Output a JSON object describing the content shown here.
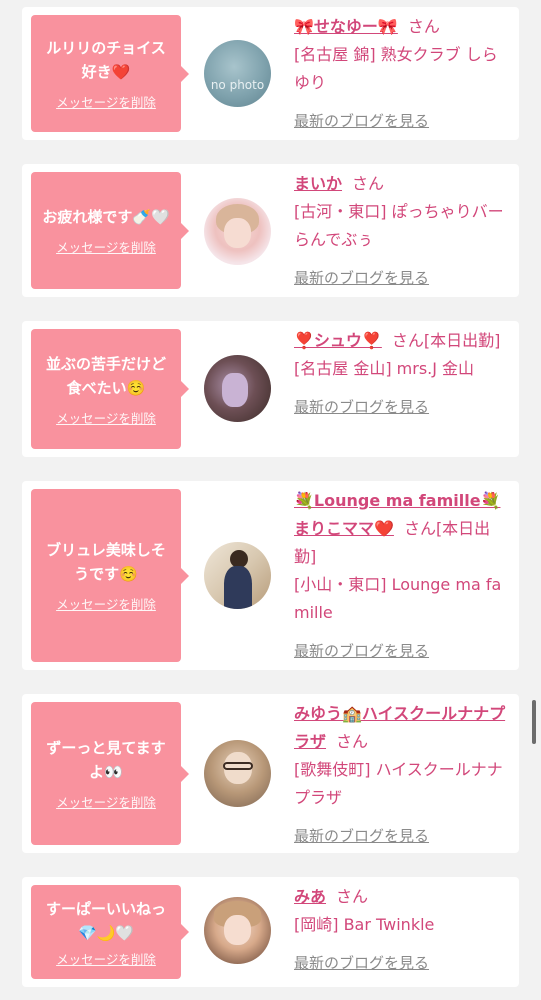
{
  "cards": [
    {
      "message": "ルリリのチョイス好き❤️",
      "delete_label": "メッセージを削除",
      "name": "🎀せなゆー🎀",
      "san": "さん",
      "shop": "[名古屋 錦] 熟女クラブ しらゆり",
      "blog_link": "最新のブログを見る",
      "avatar_text": "no photo"
    },
    {
      "message": "お疲れ様です🍼🤍",
      "delete_label": "メッセージを削除",
      "name": "まいか",
      "san": "さん",
      "shop": "[古河・東口] ぽっちゃりバー らんでぶぅ",
      "blog_link": "最新のブログを見る"
    },
    {
      "message": "並ぶの苦手だけど食べたい☺️",
      "delete_label": "メッセージを削除",
      "name": "❣️シュウ❣️",
      "san": "さん[本日出勤]",
      "shop": "[名古屋 金山] mrs.J 金山",
      "blog_link": "最新のブログを見る"
    },
    {
      "message": "ブリュレ美味しそうです☺️",
      "delete_label": "メッセージを削除",
      "name": "💐Lounge ma famille💐まりこママ❤️",
      "san": "さん[本日出勤]",
      "shop": "[小山・東口] Lounge ma famille",
      "blog_link": "最新のブログを見る"
    },
    {
      "message": "ずーっと見てますよ👀",
      "delete_label": "メッセージを削除",
      "name": "みゆう🏫ハイスクールナナプラザ",
      "san": "さん",
      "shop": "[歌舞伎町] ハイスクールナナプラザ",
      "blog_link": "最新のブログを見る"
    },
    {
      "message": "すーぱーいいねっ💎🌙🤍",
      "delete_label": "メッセージを削除",
      "name": "みあ",
      "san": "さん",
      "shop": "[岡崎] Bar Twinkle",
      "blog_link": "最新のブログを見る"
    }
  ]
}
